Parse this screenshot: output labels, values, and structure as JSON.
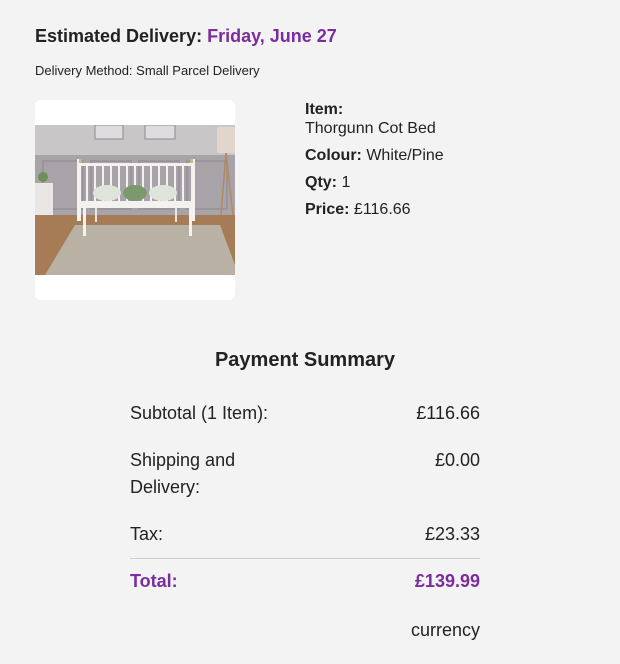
{
  "delivery": {
    "estimated_label": "Estimated Delivery:",
    "estimated_date": "Friday, June 27",
    "method_text": "Delivery Method: Small Parcel Delivery"
  },
  "product": {
    "image_alt": "Thorgunn Cot Bed",
    "item_label": "Item:",
    "item_name": "Thorgunn Cot Bed",
    "colour_label": "Colour:",
    "colour_value": "White/Pine",
    "qty_label": "Qty:",
    "qty_value": "1",
    "price_label": "Price:",
    "price_value": "£116.66"
  },
  "summary": {
    "title": "Payment Summary",
    "rows": [
      {
        "label": "Subtotal (1 Item):",
        "value": "£116.66"
      },
      {
        "label": "Shipping and Delivery:",
        "value": "£0.00"
      },
      {
        "label": "Tax:",
        "value": "£23.33"
      }
    ],
    "total_label": "Total:",
    "total_value": "£139.99",
    "currency_text": "currency"
  },
  "colors": {
    "accent": "#7b2d9e",
    "background": "#f3f3f3"
  }
}
